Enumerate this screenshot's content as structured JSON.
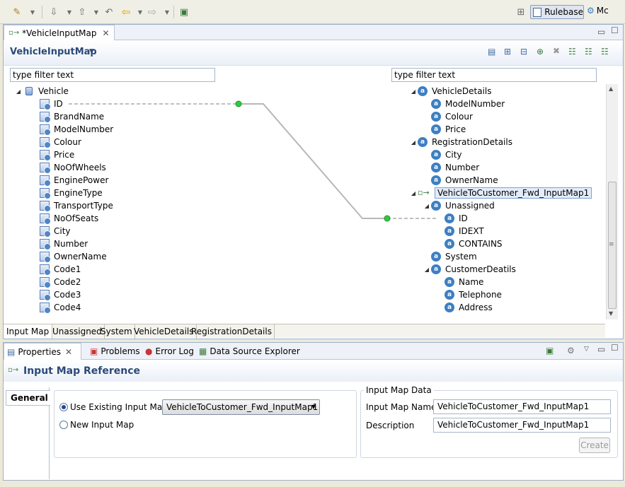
{
  "toolbar": {
    "icons": [
      "wand-icon",
      "dropdown-arrow",
      "back-history-icon",
      "forward-history-icon",
      "back-arrow-icon",
      "forward-arrow-icon",
      "open-perspective-icon"
    ],
    "perspective_label": "Rulebase",
    "perspective_other": "Mc"
  },
  "editor": {
    "tab_title": "*VehicleInputMap",
    "form_title": "VehicleInputMap",
    "left_filter_placeholder": "type filter text",
    "right_filter_placeholder": "type filter text",
    "left_tree": {
      "root": "Vehicle",
      "children": [
        "ID",
        "BrandName",
        "ModelNumber",
        "Colour",
        "Price",
        "NoOfWheels",
        "EnginePower",
        "EngineType",
        "TransportType",
        "NoOfSeats",
        "City",
        "Number",
        "OwnerName",
        "Code1",
        "Code2",
        "Code3",
        "Code4"
      ]
    },
    "right_tree": [
      {
        "label": "VehicleDetails",
        "level": 0,
        "kind": "obj",
        "expanded": true
      },
      {
        "label": "ModelNumber",
        "level": 1,
        "kind": "attr"
      },
      {
        "label": "Colour",
        "level": 1,
        "kind": "attr"
      },
      {
        "label": "Price",
        "level": 1,
        "kind": "attr"
      },
      {
        "label": "RegistrationDetails",
        "level": 0,
        "kind": "obj",
        "expanded": true
      },
      {
        "label": "City",
        "level": 1,
        "kind": "attr"
      },
      {
        "label": "Number",
        "level": 1,
        "kind": "attr"
      },
      {
        "label": "OwnerName",
        "level": 1,
        "kind": "attr"
      },
      {
        "label": "VehicleToCustomer_Fwd_InputMap1",
        "level": 0,
        "kind": "map",
        "expanded": true,
        "selected": true
      },
      {
        "label": "Unassigned",
        "level": 1,
        "kind": "obj",
        "expanded": true
      },
      {
        "label": "ID",
        "level": 2,
        "kind": "attr"
      },
      {
        "label": "IDEXT",
        "level": 2,
        "kind": "attr"
      },
      {
        "label": "CONTAINS",
        "level": 2,
        "kind": "attr"
      },
      {
        "label": "System",
        "level": 1,
        "kind": "obj"
      },
      {
        "label": "CustomerDeatils",
        "level": 1,
        "kind": "obj",
        "expanded": true
      },
      {
        "label": "Name",
        "level": 2,
        "kind": "attr"
      },
      {
        "label": "Telephone",
        "level": 2,
        "kind": "attr"
      },
      {
        "label": "Address",
        "level": 2,
        "kind": "attr"
      }
    ],
    "bottom_tabs": [
      "Input Map",
      "Unassigned",
      "System",
      "VehicleDetails",
      "RegistrationDetails"
    ]
  },
  "properties": {
    "tabs": [
      "Properties",
      "Problems",
      "Error Log",
      "Data Source Explorer"
    ],
    "title": "Input Map Reference",
    "side_tab": "General",
    "radio_existing": "Use Existing Input Map",
    "radio_new": "New Input Map",
    "existing_select_value": "VehicleToCustomer_Fwd_InputMap1",
    "group_title": "Input Map Data",
    "input_map_name_label": "Input Map Name",
    "input_map_name_value": "VehicleToCustomer_Fwd_InputMap1",
    "description_label": "Description",
    "description_value": "VehicleToCustomer_Fwd_InputMap1",
    "create_button": "Create"
  }
}
